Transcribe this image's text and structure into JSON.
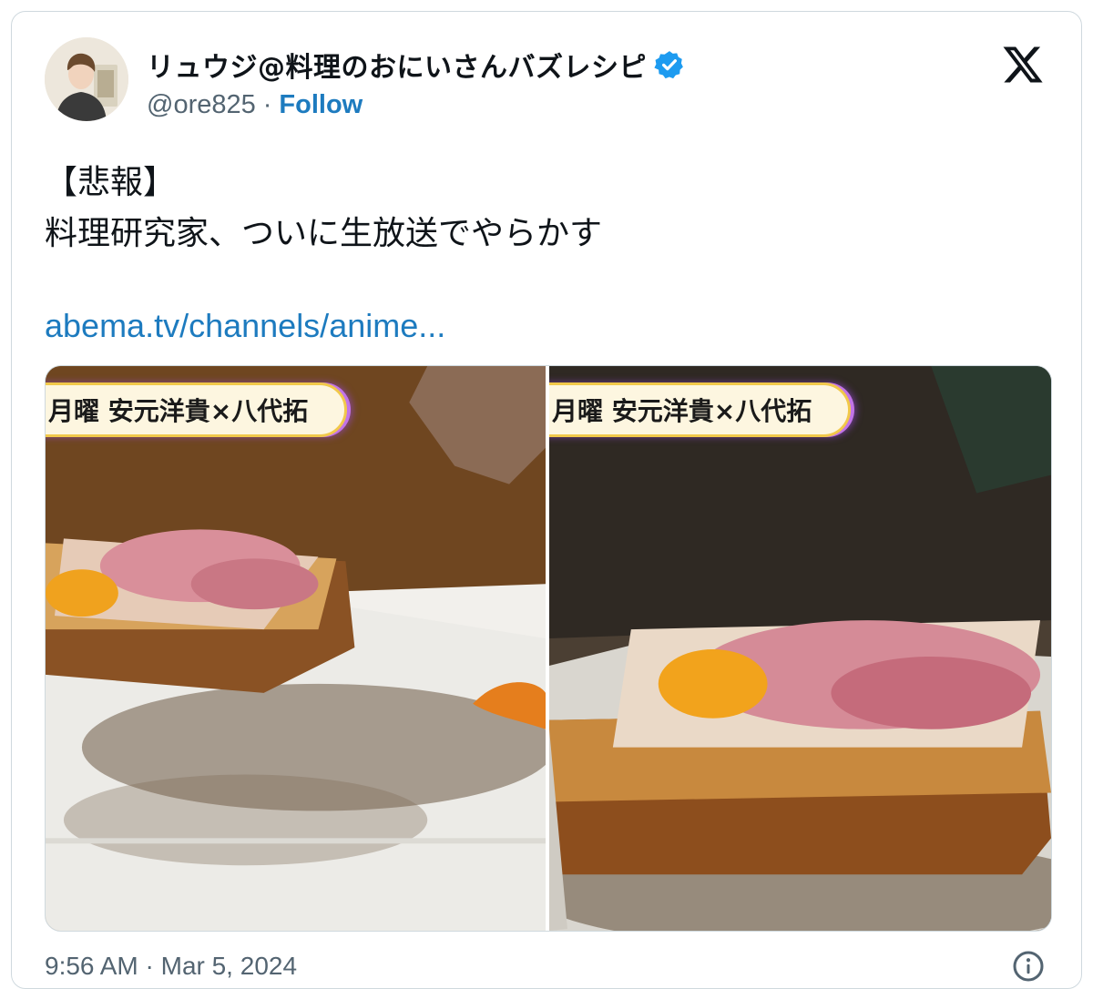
{
  "author": {
    "display_name": "リュウジ@料理のおにいさんバズレシピ",
    "handle": "@ore825",
    "separator": "·",
    "follow_label": "Follow",
    "verified": true
  },
  "tweet": {
    "line1": "【悲報】",
    "line2": "料理研究家、ついに生放送でやらかす",
    "link_text": "abema.tv/channels/anime..."
  },
  "media": {
    "left_caption": "月曜 安元洋貴×八代拓",
    "right_caption": "月曜 安元洋貴×八代拓"
  },
  "footer": {
    "timestamp": "9:56 AM · Mar 5, 2024"
  },
  "icons": {
    "x_logo": "x-logo-icon",
    "verified": "verified-badge-icon",
    "info": "info-icon"
  },
  "colors": {
    "link_blue": "#1d7bbf",
    "verified_blue": "#1d9bf0",
    "secondary_text": "#536471"
  }
}
